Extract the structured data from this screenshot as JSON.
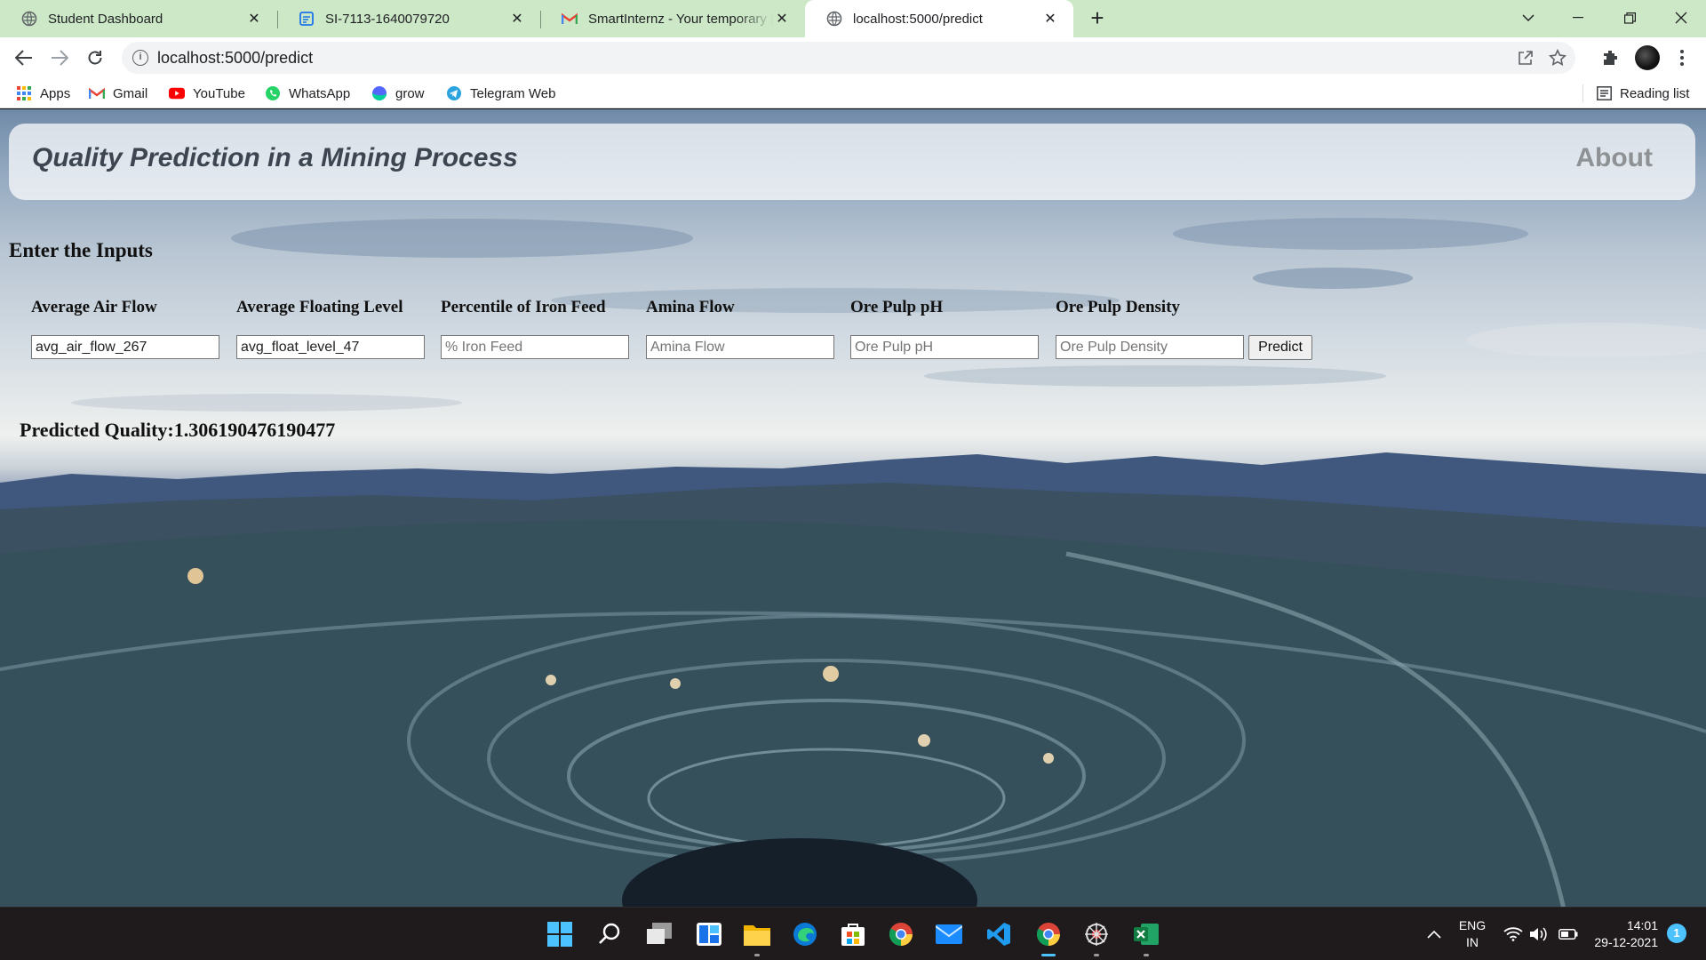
{
  "browser": {
    "tabs": [
      {
        "title": "Student Dashboard",
        "icon": "globe-icon"
      },
      {
        "title": "SI-7113-1640079720",
        "icon": "doc-icon"
      },
      {
        "title": "SmartInternz - Your temporary pa",
        "icon": "gmail-icon"
      },
      {
        "title": "localhost:5000/predict",
        "icon": "globe-icon"
      }
    ],
    "close_glyph": "✕",
    "new_tab_glyph": "+",
    "address": "localhost:5000/predict",
    "bookmarks": [
      {
        "label": "Apps",
        "icon": "apps-grid-icon"
      },
      {
        "label": "Gmail",
        "icon": "gmail-icon"
      },
      {
        "label": "YouTube",
        "icon": "youtube-icon"
      },
      {
        "label": "WhatsApp",
        "icon": "whatsapp-icon"
      },
      {
        "label": "grow",
        "icon": "grow-icon"
      },
      {
        "label": "Telegram Web",
        "icon": "telegram-icon"
      }
    ],
    "reading_list": "Reading list"
  },
  "page": {
    "brand": "Quality Prediction in a Mining Process",
    "nav_about": "About",
    "section_title": "Enter the Inputs",
    "fields": [
      {
        "label": "Average Air Flow",
        "value": "avg_air_flow_267",
        "placeholder": ""
      },
      {
        "label": "Average Floating Level",
        "value": "avg_float_level_47",
        "placeholder": ""
      },
      {
        "label": "Percentile of Iron Feed",
        "value": "",
        "placeholder": "% Iron Feed"
      },
      {
        "label": "Amina Flow",
        "value": "",
        "placeholder": "Amina Flow"
      },
      {
        "label": "Ore Pulp pH",
        "value": "",
        "placeholder": "Ore Pulp pH"
      },
      {
        "label": "Ore Pulp Density",
        "value": "",
        "placeholder": "Ore Pulp Density"
      }
    ],
    "predict_button": "Predict",
    "result": "Predicted Quality:1.306190476190477"
  },
  "taskbar": {
    "language": "ENG",
    "region": "IN",
    "time": "14:01",
    "date": "29-12-2021",
    "notification_count": "1"
  },
  "colors": {
    "tab_strip": "#cce8c6",
    "accent_blue": "#4cc2ff",
    "taskbar": "#1f1a1c"
  }
}
